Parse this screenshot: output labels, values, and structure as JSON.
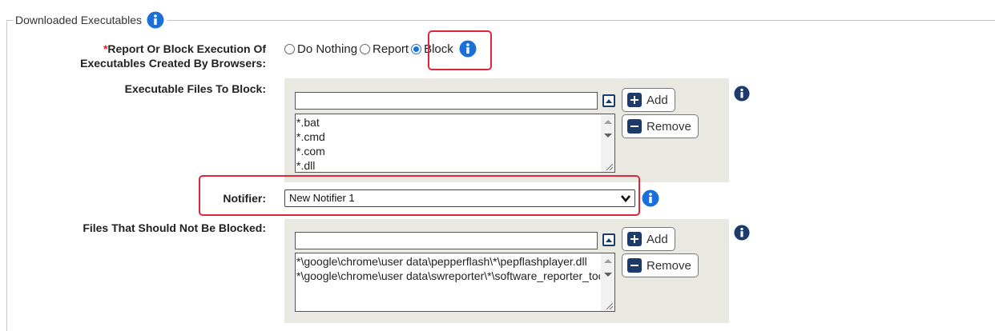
{
  "section": {
    "title": "Downloaded Executables",
    "title_icon": "info-icon"
  },
  "report_block": {
    "required_marker": "*",
    "label_line1": "Report Or Block Execution Of",
    "label_line2": "Executables Created By Browsers:",
    "options": [
      {
        "label": "Do Nothing",
        "checked": false
      },
      {
        "label": "Report",
        "checked": false
      },
      {
        "label": "Block",
        "checked": true
      }
    ]
  },
  "block_files": {
    "label": "Executable Files To Block:",
    "input_value": "",
    "add_label": "Add",
    "remove_label": "Remove",
    "items": [
      "*.bat",
      "*.cmd",
      "*.com",
      "*.dll"
    ]
  },
  "notifier": {
    "label": "Notifier:",
    "selected": "New Notifier 1"
  },
  "allow_files": {
    "label": "Files That Should Not Be Blocked:",
    "input_value": "",
    "add_label": "Add",
    "remove_label": "Remove",
    "items": [
      "*\\google\\chrome\\user data\\pepperflash\\*\\pepflashplayer.dll",
      "*\\google\\chrome\\user data\\swreporter\\*\\software_reporter_tool.exe"
    ]
  },
  "colors": {
    "accent": "#1a6fd8",
    "icon_navy": "#1c3b6a",
    "highlight": "#e0263b",
    "panel": "#e9e9e2",
    "required": "#d9232a"
  }
}
